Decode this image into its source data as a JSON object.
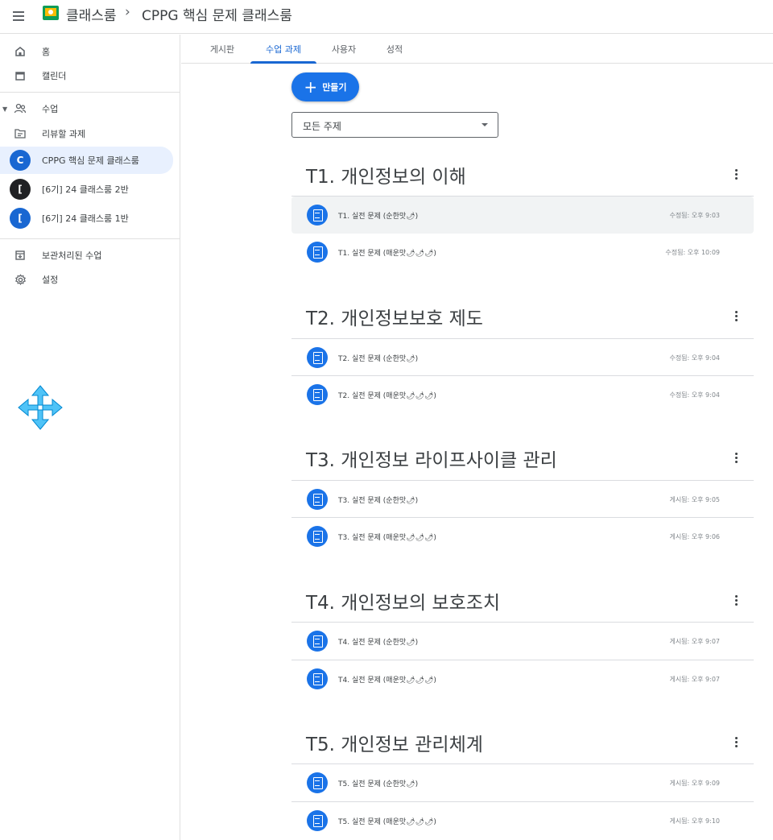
{
  "header": {
    "app_name": "클래스룸",
    "separator": "›",
    "class_title": "CPPG 핵심 문제 클래스룸"
  },
  "sidebar": {
    "home": "홈",
    "calendar": "캘린더",
    "enrolled": "수업",
    "todo": "리뷰할 과제",
    "classes": [
      {
        "initial": "C",
        "label": "CPPG 핵심 문제 클래스룸",
        "color": "#1967d2"
      },
      {
        "initial": "[",
        "label": "[6기] 24 클래스룸 2반",
        "color": "#202124"
      },
      {
        "initial": "[",
        "label": "[6기] 24 클래스룸 1반",
        "color": "#1967d2"
      }
    ],
    "archived": "보관처리된 수업",
    "settings": "설정"
  },
  "tabs": [
    "게시판",
    "수업 과제",
    "사용자",
    "성적"
  ],
  "create_button": "만들기",
  "topic_filter": "모든 주제",
  "topics": [
    {
      "title": "T1. 개인정보의 이해",
      "items": [
        {
          "name": "T1. 실전 문제 (순한맛🌶)",
          "date": "수정됨: 오후 9:03"
        },
        {
          "name": "T1. 실전 문제 (매운맛🌶🌶🌶)",
          "date": "수정됨: 오후 10:09"
        }
      ]
    },
    {
      "title": "T2. 개인정보보호 제도",
      "items": [
        {
          "name": "T2. 실전 문제 (순한맛🌶)",
          "date": "수정됨: 오후 9:04"
        },
        {
          "name": "T2. 실전 문제 (매운맛🌶🌶🌶)",
          "date": "수정됨: 오후 9:04"
        }
      ]
    },
    {
      "title": "T3. 개인정보 라이프사이클 관리",
      "items": [
        {
          "name": "T3. 실전 문제 (순한맛🌶)",
          "date": "게시됨: 오후 9:05"
        },
        {
          "name": "T3. 실전 문제 (매운맛🌶🌶🌶)",
          "date": "게시됨: 오후 9:06"
        }
      ]
    },
    {
      "title": "T4. 개인정보의 보호조치",
      "items": [
        {
          "name": "T4. 실전 문제 (순한맛🌶)",
          "date": "게시됨: 오후 9:07"
        },
        {
          "name": "T4. 실전 문제 (매운맛🌶🌶🌶)",
          "date": "게시됨: 오후 9:07"
        }
      ]
    },
    {
      "title": "T5. 개인정보 관리체계",
      "items": [
        {
          "name": "T5. 실전 문제 (순한맛🌶)",
          "date": "게시됨: 오후 9:09"
        },
        {
          "name": "T5. 실전 문제 (매운맛🌶🌶🌶)",
          "date": "게시됨: 오후 9:10"
        }
      ]
    }
  ],
  "colors": {
    "accent": "#1a73e8",
    "active_tab": "#1967d2",
    "move_icon": "#4fc3f7"
  },
  "icons": [
    "menu-icon",
    "home-icon",
    "calendar-icon",
    "people-icon",
    "todo-icon",
    "archive-icon",
    "gear-icon",
    "assignment-icon",
    "more-vert-icon",
    "move-cursor-icon"
  ]
}
